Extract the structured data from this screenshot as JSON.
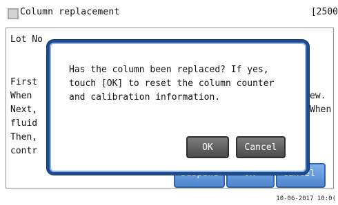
{
  "window": {
    "title": "Column replacement",
    "right_text": "[2500"
  },
  "background": {
    "lot_label": "Lot No",
    "lines_left": [
      "First",
      "When",
      "Next,",
      "fluid",
      "Then,",
      "contr"
    ],
    "lines_right": [
      "ew.",
      "When"
    ],
    "buttons": [
      "Suspend",
      "OK",
      "Cancel"
    ]
  },
  "dialog": {
    "message": "Has the column been replaced? If yes, touch [OK] to reset the column counter and calibration information.",
    "ok_label": "OK",
    "cancel_label": "Cancel"
  },
  "footer": {
    "datetime": "10-06-2017 10:0("
  },
  "colors": {
    "dialog_border": "#1e4d91",
    "blue_button": "#4f86cf",
    "gray_button": "#4b4b4b"
  }
}
